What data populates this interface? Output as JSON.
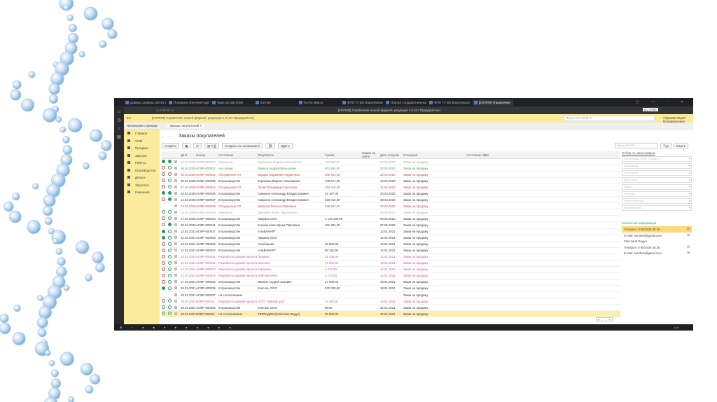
{
  "browser": {
    "tabs": [
      "Доверь сервера (2019) 10г",
      "Передача обучения курса",
      "Чиде До МИ (ОМ)",
      "Котлин",
      "Почта Mail.ru",
      "ФПО ГУ ВО Воронежский",
      "Портал государственных",
      "ФПО ГУ ВО Воронежский",
      "[КОПИЯ] Управление"
    ],
    "url": "ut.1cfresh.ru",
    "window_title": "[КОПИЯ] Управление нашей фирмой, редакция 1.6 (1С:Предприятие)",
    "sys_badge": "1С:отчёт"
  },
  "app": {
    "logo": "1С",
    "title": "[КОПИЯ] Управление нашей фирмой, редакция 1.6 (1С:Предприятие)",
    "search_placeholder": "Поиск Ctrl+Shift+F",
    "user": "Абрамов Юрий Владимирович"
  },
  "navtabs": [
    "Начальная страница",
    "Заказы покупателей ×"
  ],
  "sidebar": [
    "Главное",
    "CRM",
    "Продажи",
    "Закупки",
    "Работы",
    "Производство",
    "Деньги",
    "Зарплата",
    "Компания"
  ],
  "page": {
    "title": "Заказы покупателей",
    "create": "Создать",
    "create_based": "Создать на основании ▾",
    "edo": "ЭДО ▾",
    "search_placeholder": "Поиск (Ctrl+F)",
    "more": "Ещё ▾"
  },
  "columns": [
    "",
    "",
    "",
    "Дата",
    "Номер",
    "Состояние",
    "Покупатель",
    "Сумма",
    "Номер на сайте",
    "Дата отгрузки",
    "Операция",
    "Состояние ЭДО"
  ],
  "rows": [
    [
      "gray",
      "g",
      "g",
      "24.03.2020",
      "АСФР-000024",
      "Завершен",
      "Курочкина Марина Николаевна",
      "413 963,00",
      "07.04.2020",
      "Заказ на продажу"
    ],
    [
      "green",
      "r",
      "o",
      "06.04.2020",
      "АСФР-000032",
      "На складе",
      "Марков Андрей Евгеньевич",
      "841 854,00",
      "22.04.2020",
      "Заказ на продажу"
    ],
    [
      "red",
      "r",
      "r",
      "08.04.2020",
      "АСФР-000033",
      "Обсуждение КП",
      "Вирдюк Марианна Андреевна",
      "400 301,00",
      "20.04.2020",
      "Заказ на продажу"
    ],
    [
      "",
      "r",
      "o",
      "08.04.2020",
      "АСФР-000035",
      "В производстве",
      "Корякина Марина Николаевна",
      "379 571,00",
      "13.04.2020",
      "Заказ на продажу"
    ],
    [
      "red",
      "r",
      "o",
      "07.04.2020",
      "АСФР-000034",
      "Обсуждение КП",
      "Лалин Владимир Сергеевич",
      "419 410,50",
      "21.04.2020",
      "Заказ на продажу"
    ],
    [
      "",
      "g",
      "g",
      "10.04.2020",
      "АСФР-000036",
      "В производстве",
      "Смирнов Александр Владиславович",
      "43 197,00",
      "20.04.2020",
      "Заказ на продажу"
    ],
    [
      "",
      "r",
      "g",
      "12.04.2020",
      "АСФР-000037",
      "В производстве",
      "Смирнов Александр Владиславович",
      "318 012,50",
      "28.04.2020",
      "Заказ на продажу"
    ],
    [
      "red",
      "n",
      "n",
      "14.04.2020",
      "АСФР-000038",
      "Обсуждение КП",
      "Крюкова Татьяна Павловна",
      "349 957,00",
      "30.04.2020",
      "Заказ на продажу"
    ],
    [
      "gray",
      "o",
      "o",
      "15.04.2020",
      "АСФР-000039",
      "Завершен",
      "Зинченко Игорь Николаевич",
      "",
      "05.05.2020",
      "Заказ на продажу"
    ],
    [
      "",
      "r",
      "o",
      "17.04.2020",
      "АСФР-000040",
      "В производстве",
      "Лаврига ООО",
      "1 134 200,00",
      "05.05.2020",
      "Заказ на продажу"
    ],
    [
      "",
      "r",
      "g",
      "20.04.2020",
      "АСФР-000041",
      "В производстве",
      "Кононенская Ирина Павловна",
      "191 381,30",
      "07.05.2020",
      "Заказ на продажу"
    ],
    [
      "",
      "g",
      "o",
      "12.01.2021",
      "АСФР-000027",
      "В производстве",
      "АЛЬБАМАРТ",
      "",
      "12.01.2021",
      "Заказ на продажу"
    ],
    [
      "",
      "g",
      "o",
      "12.01.2021",
      "АСФР-000028",
      "В производстве",
      "Лаврига ООО",
      "",
      "12.01.2021",
      "Заказ на продажу"
    ],
    [
      "",
      "r",
      "o",
      "12.01.2021",
      "АСФР-000029",
      "В производстве",
      "Улыбнашка",
      "29 000,00",
      "12.01.2021",
      "Заказ на продажу"
    ],
    [
      "",
      "r",
      "o",
      "12.01.2021",
      "АСФР-000030",
      "В производстве",
      "АЛЬБАМАРТ",
      "68 115,00",
      "12.01.2021",
      "Заказ на продажу"
    ],
    [
      "pink",
      "r",
      "o",
      "12.01.2021",
      "АСФР-000031",
      "Разработка дизайн-проекта",
      "Продикс",
      "31 338,00",
      "12.01.2021",
      "Заказ на продажу"
    ],
    [
      "pink",
      "r",
      "o",
      "12.01.2021",
      "АСФР-000032",
      "Разработка дизайн-проекта",
      "Монолит",
      "71 002,00",
      "12.01.2021",
      "Заказ на продажу"
    ],
    [
      "pink",
      "r",
      "o",
      "12.01.2021",
      "АСФР-000033",
      "Разработка дизайн-проекта",
      "Карамель",
      "2 513,00",
      "12.01.2021",
      "Заказ на продажу"
    ],
    [
      "pink",
      "r",
      "o",
      "12.01.2021",
      "АСФР-000034",
      "Разработка дизайн-проекта",
      "1000 мелочей",
      "2 170,00",
      "12.01.2021",
      "Заказ на продажу"
    ],
    [
      "",
      "r",
      "o",
      "17.01.2021",
      "АСФР-000035",
      "В производстве",
      "Иванов Андрей Львович",
      "17 000,00",
      "18.01.2021",
      "Заказ на продажу"
    ],
    [
      "",
      "g",
      "o",
      "18.01.2021",
      "АСФР-000036",
      "В производстве",
      "Консоль ООО",
      "570 000,00",
      "18.01.2021",
      "Заказ на продажу"
    ],
    [
      "",
      "n",
      "n",
      "18.01.2021",
      "АСФР-000037",
      "На согласовании",
      "",
      "",
      "",
      "Заказ на продажу"
    ],
    [
      "pink",
      "r",
      "o",
      "18.01.2021",
      "00ФР-000011",
      "Разработка дизайн-проекта",
      "ООО \"Чайный дом\"",
      "11 040,00",
      "18.01.2021",
      "Заказ на продажу"
    ],
    [
      "",
      "o",
      "o",
      "19.01.2021",
      "АСФР-000038",
      "В производстве",
      "Консоль ООО",
      "96,00",
      "22.01.2021",
      "Заказ на продажу"
    ],
    [
      "sel",
      "o",
      "o",
      "19.01.2021",
      "00ФР-000012",
      "На согласовании",
      "ТВЕРЬДОМ (Светлана Федун)",
      "35 000,00",
      "22.01.2021",
      "Заказ на продажу"
    ]
  ],
  "filters": {
    "label": "Отбор по заказ-живым",
    "fields": [
      "Покупатель, ИНН, телефон",
      "Вид заказа",
      "Состояние",
      "Мой заказ",
      "Заказ",
      "Отгрузка",
      "Ответственный",
      "Организация"
    ]
  },
  "contacts": {
    "title": "Контактная информация",
    "items": [
      "Телефон: 8 800 535 35 35",
      "E-mail: tverdom@gmail.com",
      "Светлана Федун",
      "Телефон: 8 800 535 35 35",
      "E-mail: tverdom@gmail.com"
    ]
  },
  "taskbar": {
    "clock": "14:0"
  }
}
